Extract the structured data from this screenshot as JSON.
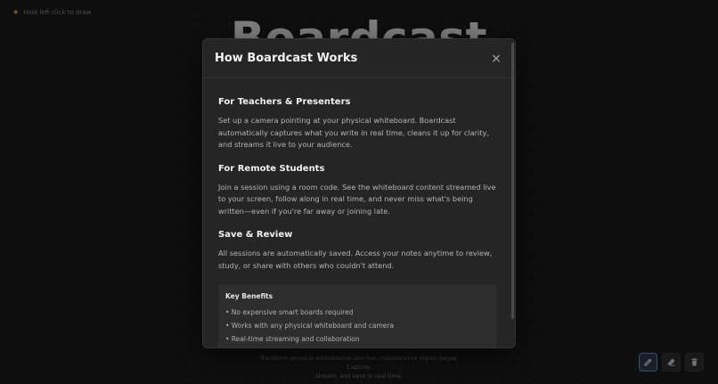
{
  "hint": {
    "icon": "star-icon",
    "text": "Hold left click to draw"
  },
  "background_title": "Boardcast",
  "footer": {
    "line1": "Transform physical whiteboards into live, collaborative digital pages. Capture,",
    "line2": "stream, and save in real time."
  },
  "toolbar": {
    "pen": "pencil-icon",
    "eraser": "eraser-icon",
    "clear": "trash-icon",
    "active_tool": "pen",
    "accent_color": "#6b8fc7"
  },
  "modal": {
    "title": "How Boardcast Works",
    "close_label": "×",
    "sections": [
      {
        "heading": "For Teachers & Presenters",
        "body": "Set up a camera pointing at your physical whiteboard. Boardcast automatically captures what you write in real time, cleans it up for clarity, and streams it live to your audience."
      },
      {
        "heading": "For Remote Students",
        "body": "Join a session using a room code. See the whiteboard content streamed live to your screen, follow along in real time, and never miss what's being written—even if you're far away or joining late."
      },
      {
        "heading": "Save & Review",
        "body": "All sessions are automatically saved. Access your notes anytime to review, study, or share with others who couldn't attend."
      }
    ],
    "benefits": {
      "heading": "Key Benefits",
      "items": [
        "• No expensive smart boards required",
        "• Works with any physical whiteboard and camera",
        "• Real-time streaming and collaboration"
      ]
    }
  }
}
